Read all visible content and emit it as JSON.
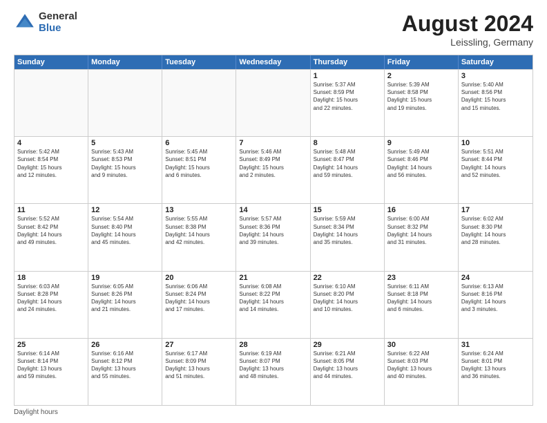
{
  "logo": {
    "general": "General",
    "blue": "Blue"
  },
  "title": {
    "month": "August 2024",
    "location": "Leissling, Germany"
  },
  "header_days": [
    "Sunday",
    "Monday",
    "Tuesday",
    "Wednesday",
    "Thursday",
    "Friday",
    "Saturday"
  ],
  "weeks": [
    [
      {
        "day": "",
        "info": ""
      },
      {
        "day": "",
        "info": ""
      },
      {
        "day": "",
        "info": ""
      },
      {
        "day": "",
        "info": ""
      },
      {
        "day": "1",
        "info": "Sunrise: 5:37 AM\nSunset: 8:59 PM\nDaylight: 15 hours\nand 22 minutes."
      },
      {
        "day": "2",
        "info": "Sunrise: 5:39 AM\nSunset: 8:58 PM\nDaylight: 15 hours\nand 19 minutes."
      },
      {
        "day": "3",
        "info": "Sunrise: 5:40 AM\nSunset: 8:56 PM\nDaylight: 15 hours\nand 15 minutes."
      }
    ],
    [
      {
        "day": "4",
        "info": "Sunrise: 5:42 AM\nSunset: 8:54 PM\nDaylight: 15 hours\nand 12 minutes."
      },
      {
        "day": "5",
        "info": "Sunrise: 5:43 AM\nSunset: 8:53 PM\nDaylight: 15 hours\nand 9 minutes."
      },
      {
        "day": "6",
        "info": "Sunrise: 5:45 AM\nSunset: 8:51 PM\nDaylight: 15 hours\nand 6 minutes."
      },
      {
        "day": "7",
        "info": "Sunrise: 5:46 AM\nSunset: 8:49 PM\nDaylight: 15 hours\nand 2 minutes."
      },
      {
        "day": "8",
        "info": "Sunrise: 5:48 AM\nSunset: 8:47 PM\nDaylight: 14 hours\nand 59 minutes."
      },
      {
        "day": "9",
        "info": "Sunrise: 5:49 AM\nSunset: 8:46 PM\nDaylight: 14 hours\nand 56 minutes."
      },
      {
        "day": "10",
        "info": "Sunrise: 5:51 AM\nSunset: 8:44 PM\nDaylight: 14 hours\nand 52 minutes."
      }
    ],
    [
      {
        "day": "11",
        "info": "Sunrise: 5:52 AM\nSunset: 8:42 PM\nDaylight: 14 hours\nand 49 minutes."
      },
      {
        "day": "12",
        "info": "Sunrise: 5:54 AM\nSunset: 8:40 PM\nDaylight: 14 hours\nand 45 minutes."
      },
      {
        "day": "13",
        "info": "Sunrise: 5:55 AM\nSunset: 8:38 PM\nDaylight: 14 hours\nand 42 minutes."
      },
      {
        "day": "14",
        "info": "Sunrise: 5:57 AM\nSunset: 8:36 PM\nDaylight: 14 hours\nand 39 minutes."
      },
      {
        "day": "15",
        "info": "Sunrise: 5:59 AM\nSunset: 8:34 PM\nDaylight: 14 hours\nand 35 minutes."
      },
      {
        "day": "16",
        "info": "Sunrise: 6:00 AM\nSunset: 8:32 PM\nDaylight: 14 hours\nand 31 minutes."
      },
      {
        "day": "17",
        "info": "Sunrise: 6:02 AM\nSunset: 8:30 PM\nDaylight: 14 hours\nand 28 minutes."
      }
    ],
    [
      {
        "day": "18",
        "info": "Sunrise: 6:03 AM\nSunset: 8:28 PM\nDaylight: 14 hours\nand 24 minutes."
      },
      {
        "day": "19",
        "info": "Sunrise: 6:05 AM\nSunset: 8:26 PM\nDaylight: 14 hours\nand 21 minutes."
      },
      {
        "day": "20",
        "info": "Sunrise: 6:06 AM\nSunset: 8:24 PM\nDaylight: 14 hours\nand 17 minutes."
      },
      {
        "day": "21",
        "info": "Sunrise: 6:08 AM\nSunset: 8:22 PM\nDaylight: 14 hours\nand 14 minutes."
      },
      {
        "day": "22",
        "info": "Sunrise: 6:10 AM\nSunset: 8:20 PM\nDaylight: 14 hours\nand 10 minutes."
      },
      {
        "day": "23",
        "info": "Sunrise: 6:11 AM\nSunset: 8:18 PM\nDaylight: 14 hours\nand 6 minutes."
      },
      {
        "day": "24",
        "info": "Sunrise: 6:13 AM\nSunset: 8:16 PM\nDaylight: 14 hours\nand 3 minutes."
      }
    ],
    [
      {
        "day": "25",
        "info": "Sunrise: 6:14 AM\nSunset: 8:14 PM\nDaylight: 13 hours\nand 59 minutes."
      },
      {
        "day": "26",
        "info": "Sunrise: 6:16 AM\nSunset: 8:12 PM\nDaylight: 13 hours\nand 55 minutes."
      },
      {
        "day": "27",
        "info": "Sunrise: 6:17 AM\nSunset: 8:09 PM\nDaylight: 13 hours\nand 51 minutes."
      },
      {
        "day": "28",
        "info": "Sunrise: 6:19 AM\nSunset: 8:07 PM\nDaylight: 13 hours\nand 48 minutes."
      },
      {
        "day": "29",
        "info": "Sunrise: 6:21 AM\nSunset: 8:05 PM\nDaylight: 13 hours\nand 44 minutes."
      },
      {
        "day": "30",
        "info": "Sunrise: 6:22 AM\nSunset: 8:03 PM\nDaylight: 13 hours\nand 40 minutes."
      },
      {
        "day": "31",
        "info": "Sunrise: 6:24 AM\nSunset: 8:01 PM\nDaylight: 13 hours\nand 36 minutes."
      }
    ]
  ],
  "footer": {
    "note": "Daylight hours"
  }
}
